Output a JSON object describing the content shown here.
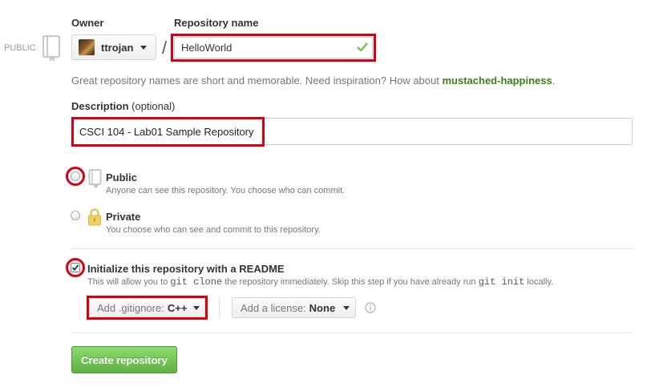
{
  "side": {
    "badge_label": "PUBLIC"
  },
  "owner": {
    "label": "Owner",
    "selected": "ttrojan"
  },
  "separator": "/",
  "repo_name": {
    "label": "Repository name",
    "value": "HelloWorld"
  },
  "suggestion": {
    "text": "Great repository names are short and memorable. Need inspiration? How about",
    "name": "mustached-happiness",
    "end": "."
  },
  "description": {
    "label": "Description",
    "optional": "(optional)",
    "value": "CSCI 104 - Lab01 Sample Repository"
  },
  "visibility": {
    "public": {
      "title": "Public",
      "desc": "Anyone can see this repository. You choose who can commit.",
      "selected": true
    },
    "private": {
      "title": "Private",
      "desc": "You choose who can see and commit to this repository.",
      "selected": false
    }
  },
  "readme": {
    "title": "Initialize this repository with a README",
    "checked": true,
    "desc_1": "This will allow you to",
    "code_1": "git clone",
    "desc_2": "the repository immediately. Skip this step if you have already run",
    "code_2": "git init",
    "desc_3": "locally."
  },
  "gitignore": {
    "prefix": "Add .gitignore:",
    "value": "C++"
  },
  "license": {
    "prefix": "Add a license:",
    "value": "None"
  },
  "submit": {
    "label": "Create repository"
  },
  "colors": {
    "highlight_red": "#d80010",
    "success_green": "#6cc644",
    "suggestion_green": "#3b7e1b",
    "button_green": "#60b044"
  }
}
